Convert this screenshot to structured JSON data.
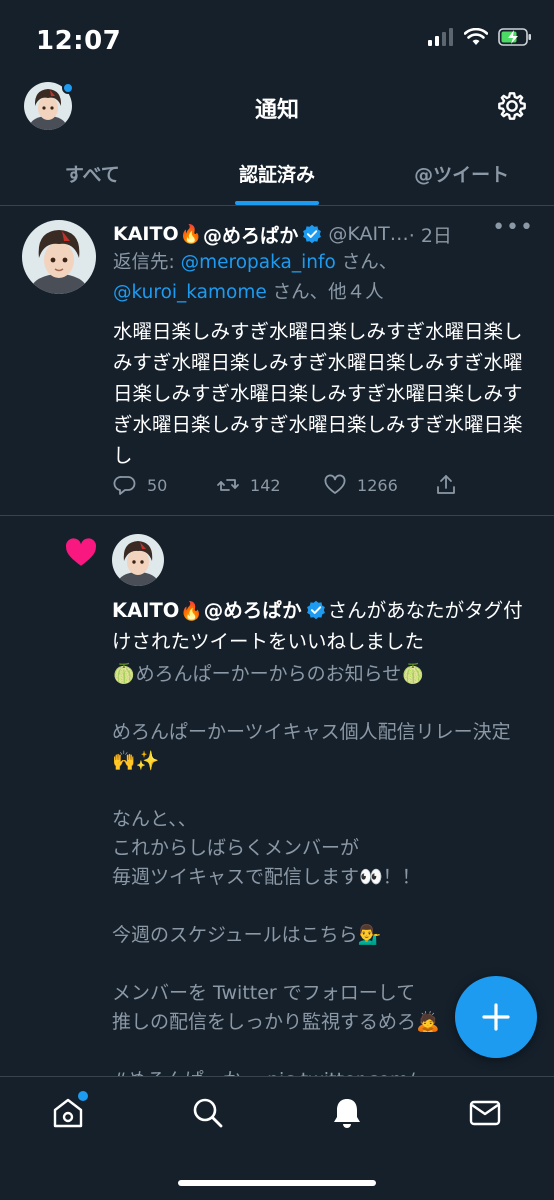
{
  "status_bar": {
    "time": "12:07"
  },
  "header": {
    "title": "通知",
    "avatar_icon": "user-avatar",
    "settings_icon": "gear-icon"
  },
  "tabs": [
    {
      "label": "すべて",
      "active": false
    },
    {
      "label": "認証済み",
      "active": true
    },
    {
      "label": "@ツイート",
      "active": false
    }
  ],
  "tweet": {
    "name": "KAITO",
    "name_suffix": "@めろぱか",
    "handle": "@KAIT…",
    "time": "· 2日",
    "reply_prefix": "返信先: ",
    "reply_user1": "@meropaka_info",
    "reply_mid": " さん、",
    "reply_user2": "@kuroi_kamome",
    "reply_end": " さん、他４人",
    "text": "水曜日楽しみすぎ水曜日楽しみすぎ水曜日楽しみすぎ水曜日楽しみすぎ水曜日楽しみすぎ水曜日楽しみすぎ水曜日楽しみすぎ水曜日楽しみすぎ水曜日楽しみすぎ水曜日楽しみすぎ水曜日楽し",
    "replies": "50",
    "retweets": "142",
    "likes": "1266"
  },
  "like_notification": {
    "name": "KAITO",
    "name_suffix": "@めろぱか",
    "message": "さんがあなたがタグ付けされたツイートをいいねしました",
    "body": "🍈めろんぱーかーからのお知らせ🍈\n\nめろんぱーかーツイキャス個人配信リレー決定🙌✨\n\nなんと、、\nこれからしばらくメンバーが\n毎週ツイキャスで配信します👀！！\n\n今週のスケジュールはこちら💁‍♂️\n\nメンバーを Twitter でフォローして\n推しの配信をしっかり監視するめろ🙇\n\n#めろんぱーかー pic.twitter.com/"
  },
  "fab": {
    "icon": "plus-icon"
  },
  "tab_bar": [
    "home-icon",
    "search-icon",
    "bell-icon",
    "mail-icon"
  ],
  "colors": {
    "background": "#15202b",
    "accent": "#1d9bf0",
    "muted": "#8b98a5",
    "like": "#f91880"
  }
}
